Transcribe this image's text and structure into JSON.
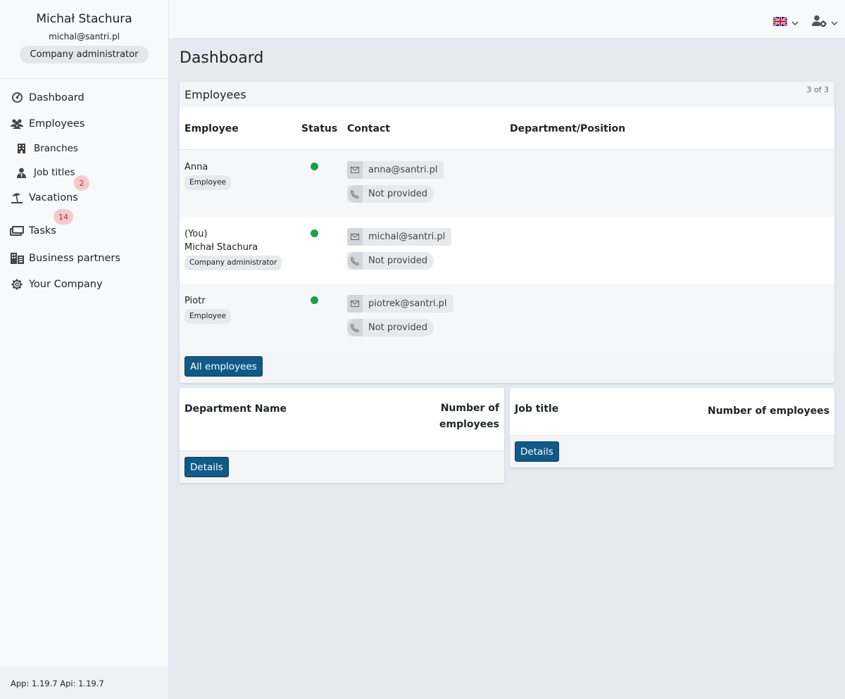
{
  "user": {
    "name": "Michał Stachura",
    "email": "michal@santri.pl",
    "role": "Company administrator"
  },
  "nav": {
    "dashboard": "Dashboard",
    "employees": "Employees",
    "branches": "Branches",
    "job_titles": "Job titles",
    "vacations": "Vacations",
    "vacations_badge": "2",
    "tasks": "Tasks",
    "tasks_badge": "14",
    "business_partners": "Business partners",
    "your_company": "Your Company"
  },
  "version": "App: 1.19.7 Api: 1.19.7",
  "topbar": {
    "language_icon": "uk-flag-icon",
    "user_menu_icon": "user-settings-icon"
  },
  "page": {
    "title": "Dashboard"
  },
  "employees_card": {
    "title": "Employees",
    "count": "3 of 3",
    "columns": {
      "employee": "Employee",
      "status": "Status",
      "contact": "Contact",
      "department": "Department/Position"
    },
    "rows": [
      {
        "you": "",
        "name": "Anna",
        "role": "Employee",
        "email": "anna@santri.pl",
        "phone": "Not provided"
      },
      {
        "you": "(You)",
        "name": "Michał Stachura",
        "role": "Company administrator",
        "email": "michal@santri.pl",
        "phone": "Not provided"
      },
      {
        "you": "",
        "name": "Piotr",
        "role": "Employee",
        "email": "piotrek@santri.pl",
        "phone": "Not provided"
      }
    ],
    "status_color": "#1e9e4a",
    "button": "All employees"
  },
  "departments_card": {
    "col_name": "Department Name",
    "col_count_1": "Number of",
    "col_count_2": "employees",
    "button": "Details"
  },
  "jobs_card": {
    "col_name": "Job title",
    "col_count": "Number of employees",
    "button": "Details"
  },
  "colors": {
    "primary": "#0f5a87",
    "badge": "#f8c9c9",
    "status_active": "#1e9e4a"
  }
}
